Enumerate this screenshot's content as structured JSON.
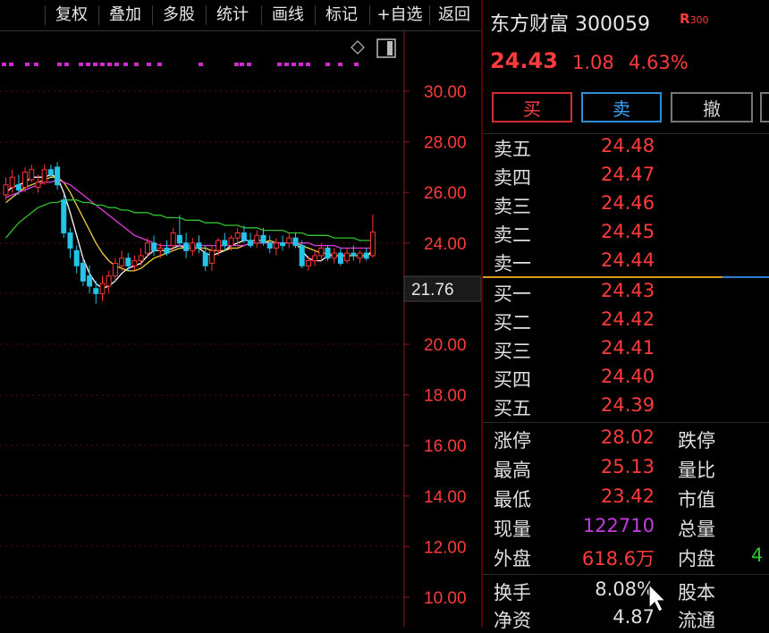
{
  "toolbar": {
    "items": [
      "复权",
      "叠加",
      "多股",
      "统计",
      "画线",
      "标记",
      "+自选",
      "返回"
    ]
  },
  "chart_data": {
    "type": "candlestick",
    "price_axis": {
      "ticks": [
        "30.00",
        "28.00",
        "26.00",
        "24.00",
        "20.00",
        "18.00",
        "16.00",
        "14.00",
        "12.00",
        "10.00"
      ],
      "crosshair_label": "21.76"
    },
    "candles": [
      {
        "o": 25.9,
        "h": 26.6,
        "l": 25.7,
        "c": 26.3
      },
      {
        "o": 26.2,
        "h": 26.9,
        "l": 26.0,
        "c": 26.6
      },
      {
        "o": 26.3,
        "h": 26.7,
        "l": 25.9,
        "c": 26.1
      },
      {
        "o": 26.2,
        "h": 27.0,
        "l": 26.0,
        "c": 26.8
      },
      {
        "o": 26.5,
        "h": 27.1,
        "l": 26.4,
        "c": 26.9
      },
      {
        "o": 26.2,
        "h": 26.7,
        "l": 26.0,
        "c": 26.4
      },
      {
        "o": 26.4,
        "h": 27.1,
        "l": 26.3,
        "c": 26.9
      },
      {
        "o": 26.9,
        "h": 27.1,
        "l": 26.6,
        "c": 26.7
      },
      {
        "o": 27.0,
        "h": 27.2,
        "l": 26.1,
        "c": 26.3
      },
      {
        "o": 25.7,
        "h": 25.9,
        "l": 24.2,
        "c": 24.4
      },
      {
        "o": 24.4,
        "h": 24.6,
        "l": 23.4,
        "c": 23.8
      },
      {
        "o": 23.7,
        "h": 23.9,
        "l": 22.8,
        "c": 23.1
      },
      {
        "o": 23.2,
        "h": 23.4,
        "l": 22.3,
        "c": 22.5
      },
      {
        "o": 22.7,
        "h": 23.1,
        "l": 22.0,
        "c": 22.3
      },
      {
        "o": 22.2,
        "h": 22.5,
        "l": 21.6,
        "c": 22.0
      },
      {
        "o": 22.0,
        "h": 22.7,
        "l": 21.7,
        "c": 22.4
      },
      {
        "o": 22.3,
        "h": 22.9,
        "l": 22.0,
        "c": 22.7
      },
      {
        "o": 22.7,
        "h": 23.4,
        "l": 22.5,
        "c": 23.2
      },
      {
        "o": 23.1,
        "h": 23.7,
        "l": 22.9,
        "c": 23.4
      },
      {
        "o": 23.4,
        "h": 23.6,
        "l": 22.9,
        "c": 23.1
      },
      {
        "o": 23.1,
        "h": 23.5,
        "l": 22.9,
        "c": 23.3
      },
      {
        "o": 23.3,
        "h": 23.8,
        "l": 23.1,
        "c": 23.5
      },
      {
        "o": 23.6,
        "h": 24.2,
        "l": 23.4,
        "c": 24.0
      },
      {
        "o": 24.0,
        "h": 24.3,
        "l": 23.5,
        "c": 23.7
      },
      {
        "o": 23.7,
        "h": 24.0,
        "l": 23.4,
        "c": 23.8
      },
      {
        "o": 23.8,
        "h": 24.1,
        "l": 23.5,
        "c": 23.6
      },
      {
        "o": 23.9,
        "h": 24.6,
        "l": 23.7,
        "c": 24.4
      },
      {
        "o": 24.3,
        "h": 25.1,
        "l": 23.9,
        "c": 24.0
      },
      {
        "o": 24.0,
        "h": 24.4,
        "l": 23.4,
        "c": 23.7
      },
      {
        "o": 23.7,
        "h": 24.2,
        "l": 23.5,
        "c": 24.0
      },
      {
        "o": 24.0,
        "h": 24.3,
        "l": 23.6,
        "c": 23.8
      },
      {
        "o": 23.6,
        "h": 23.9,
        "l": 22.9,
        "c": 23.1
      },
      {
        "o": 23.2,
        "h": 23.9,
        "l": 22.9,
        "c": 23.7
      },
      {
        "o": 23.7,
        "h": 24.2,
        "l": 23.5,
        "c": 24.1
      },
      {
        "o": 24.1,
        "h": 24.4,
        "l": 23.7,
        "c": 23.9
      },
      {
        "o": 23.9,
        "h": 24.3,
        "l": 23.7,
        "c": 24.2
      },
      {
        "o": 24.2,
        "h": 24.6,
        "l": 23.9,
        "c": 24.4
      },
      {
        "o": 24.4,
        "h": 24.7,
        "l": 24.0,
        "c": 24.1
      },
      {
        "o": 24.1,
        "h": 24.4,
        "l": 23.8,
        "c": 23.9
      },
      {
        "o": 24.0,
        "h": 24.5,
        "l": 23.8,
        "c": 24.3
      },
      {
        "o": 24.3,
        "h": 24.6,
        "l": 23.9,
        "c": 24.0
      },
      {
        "o": 24.0,
        "h": 24.3,
        "l": 23.6,
        "c": 23.8
      },
      {
        "o": 23.8,
        "h": 24.2,
        "l": 23.5,
        "c": 24.0
      },
      {
        "o": 24.0,
        "h": 24.3,
        "l": 23.7,
        "c": 23.9
      },
      {
        "o": 24.0,
        "h": 24.4,
        "l": 23.8,
        "c": 24.2
      },
      {
        "o": 24.2,
        "h": 24.4,
        "l": 23.8,
        "c": 23.9
      },
      {
        "o": 23.9,
        "h": 24.1,
        "l": 23.0,
        "c": 23.1
      },
      {
        "o": 23.1,
        "h": 23.5,
        "l": 22.9,
        "c": 23.3
      },
      {
        "o": 23.3,
        "h": 23.7,
        "l": 23.1,
        "c": 23.5
      },
      {
        "o": 23.5,
        "h": 24.0,
        "l": 23.3,
        "c": 23.8
      },
      {
        "o": 23.8,
        "h": 23.9,
        "l": 23.3,
        "c": 23.4
      },
      {
        "o": 23.4,
        "h": 23.8,
        "l": 23.2,
        "c": 23.6
      },
      {
        "o": 23.6,
        "h": 23.8,
        "l": 23.1,
        "c": 23.2
      },
      {
        "o": 23.3,
        "h": 23.8,
        "l": 23.2,
        "c": 23.6
      },
      {
        "o": 23.6,
        "h": 23.9,
        "l": 23.3,
        "c": 23.5
      },
      {
        "o": 23.4,
        "h": 23.7,
        "l": 23.2,
        "c": 23.6
      },
      {
        "o": 23.6,
        "h": 23.8,
        "l": 23.3,
        "c": 23.4
      },
      {
        "o": 23.5,
        "h": 25.13,
        "l": 23.42,
        "c": 24.43
      }
    ],
    "series": [
      {
        "color": "#ffffff",
        "values": [
          26.0,
          26.2,
          26.3,
          26.4,
          26.6,
          26.6,
          26.6,
          26.7,
          26.6,
          26.0,
          25.2,
          24.3,
          23.4,
          22.8,
          22.4,
          22.2,
          22.3,
          22.5,
          22.8,
          23.0,
          23.1,
          23.2,
          23.5,
          23.7,
          23.7,
          23.7,
          23.8,
          23.9,
          23.8,
          23.8,
          23.8,
          23.6,
          23.5,
          23.6,
          23.7,
          23.9,
          24.0,
          24.1,
          24.1,
          24.1,
          24.1,
          24.0,
          24.0,
          24.0,
          24.0,
          24.0,
          23.7,
          23.4,
          23.3,
          23.3,
          23.5,
          23.5,
          23.5,
          23.5,
          23.5,
          23.5,
          23.5,
          23.7
        ]
      },
      {
        "color": "#f2d13c",
        "values": [
          25.6,
          25.8,
          26.0,
          26.2,
          26.3,
          26.4,
          26.5,
          26.6,
          26.6,
          26.4,
          26.0,
          25.5,
          25.0,
          24.5,
          24.0,
          23.6,
          23.3,
          23.1,
          23.0,
          22.9,
          22.9,
          23.0,
          23.2,
          23.4,
          23.5,
          23.6,
          23.7,
          23.8,
          23.8,
          23.8,
          23.8,
          23.8,
          23.7,
          23.7,
          23.7,
          23.8,
          23.8,
          23.9,
          24.0,
          24.0,
          24.0,
          24.1,
          24.0,
          24.0,
          24.0,
          24.0,
          23.9,
          23.8,
          23.7,
          23.6,
          23.6,
          23.5,
          23.5,
          23.5,
          23.5,
          23.5,
          23.5,
          23.6
        ]
      },
      {
        "color": "#e03ae0",
        "values": [
          25.8,
          25.9,
          26.0,
          26.1,
          26.2,
          26.3,
          26.4,
          26.4,
          26.5,
          26.4,
          26.3,
          26.1,
          25.9,
          25.7,
          25.5,
          25.3,
          25.1,
          24.9,
          24.7,
          24.5,
          24.3,
          24.2,
          24.1,
          24.0,
          23.9,
          23.9,
          23.9,
          23.9,
          23.9,
          23.9,
          23.9,
          23.9,
          23.9,
          23.9,
          23.9,
          23.9,
          23.9,
          23.9,
          24.0,
          24.0,
          24.0,
          24.0,
          24.0,
          24.0,
          24.0,
          24.0,
          24.0,
          24.0,
          23.9,
          23.9,
          23.9,
          23.9,
          23.8,
          23.8,
          23.8,
          23.8,
          23.8,
          23.8
        ]
      },
      {
        "color": "#2fc32f",
        "values": [
          24.2,
          24.5,
          24.8,
          25.0,
          25.2,
          25.4,
          25.5,
          25.6,
          25.6,
          25.7,
          25.7,
          25.7,
          25.6,
          25.6,
          25.5,
          25.5,
          25.4,
          25.4,
          25.3,
          25.3,
          25.2,
          25.2,
          25.2,
          25.1,
          25.1,
          25.0,
          25.0,
          25.0,
          24.9,
          24.9,
          24.9,
          24.8,
          24.8,
          24.8,
          24.7,
          24.7,
          24.7,
          24.6,
          24.6,
          24.6,
          24.5,
          24.5,
          24.5,
          24.5,
          24.4,
          24.4,
          24.4,
          24.3,
          24.3,
          24.3,
          24.3,
          24.2,
          24.2,
          24.2,
          24.2,
          24.1,
          24.1,
          24.1
        ]
      }
    ],
    "up_color": "#ff3333",
    "down_color": "#23c4e8"
  },
  "quote": {
    "name": "东方财富 300059",
    "flag": "R",
    "flag_sub": "300",
    "price": "24.43",
    "change": "1.08",
    "change_pct": "4.63%"
  },
  "actions": {
    "buy": "买",
    "sell": "卖",
    "cancel": "撤"
  },
  "orderbook": {
    "asks": [
      {
        "label": "卖五",
        "price": "24.48"
      },
      {
        "label": "卖四",
        "price": "24.47"
      },
      {
        "label": "卖三",
        "price": "24.46"
      },
      {
        "label": "卖二",
        "price": "24.45"
      },
      {
        "label": "卖一",
        "price": "24.44"
      }
    ],
    "bids": [
      {
        "label": "买一",
        "price": "24.43"
      },
      {
        "label": "买二",
        "price": "24.42"
      },
      {
        "label": "买三",
        "price": "24.41"
      },
      {
        "label": "买四",
        "price": "24.40"
      },
      {
        "label": "买五",
        "price": "24.39"
      }
    ]
  },
  "stats": {
    "limit_up_label": "涨停",
    "limit_up": "28.02",
    "limit_down_label": "跌停",
    "high_label": "最高",
    "high": "25.13",
    "vol_ratio_label": "量比",
    "low_label": "最低",
    "low": "23.42",
    "mktcap_label": "市值",
    "cur_vol_label": "现量",
    "cur_vol": "122710",
    "total_vol_label": "总量",
    "outer_label": "外盘",
    "outer": "618.6万",
    "inner_label": "内盘",
    "inner": "4",
    "turnover_label": "换手",
    "turnover": "8.08%",
    "share_label": "股本",
    "net_asset_label": "净资",
    "net_asset": "4.87",
    "float_label": "流通"
  },
  "colors": {
    "red": "#ff3b3b",
    "green": "#2fc32f",
    "purple": "#c23ce0",
    "cyan": "#23c4e8"
  }
}
